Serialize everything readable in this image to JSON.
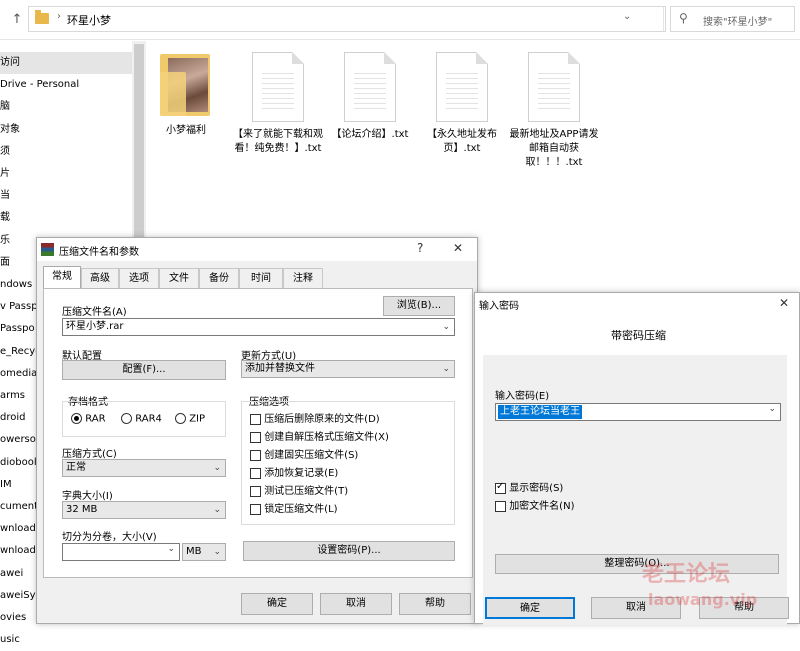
{
  "explorer": {
    "address": "环星小梦",
    "search_placeholder": "搜索\"环星小梦\"",
    "sidebar": [
      "访问",
      "Drive - Personal",
      "脑",
      "对象",
      "须",
      "片",
      "当",
      "载",
      "乐",
      "面",
      "ndows (",
      "v Passpo",
      "Passpo",
      "e_Recyc",
      "omedia",
      "arms",
      "droid",
      "owersof",
      "diobool",
      "IM",
      "cument",
      "wnload",
      "wnload",
      "awei",
      "aweiSys",
      "ovies",
      "usic"
    ],
    "files": [
      {
        "name": "小梦福利",
        "type": "folder"
      },
      {
        "name": "【来了就能下载和观看！纯免费！】.txt",
        "type": "txt"
      },
      {
        "name": "【论坛介绍】.txt",
        "type": "txt"
      },
      {
        "name": "【永久地址发布页】.txt",
        "type": "txt"
      },
      {
        "name": "最新地址及APP请发邮箱自动获取！！！.txt",
        "type": "txt"
      }
    ]
  },
  "dlg1": {
    "title": "压缩文件名和参数",
    "help_btn": "?",
    "close_btn": "✕",
    "tabs": [
      "常规",
      "高级",
      "选项",
      "文件",
      "备份",
      "时间",
      "注释"
    ],
    "archive_name_label": "压缩文件名(A)",
    "browse": "浏览(B)...",
    "archive_name": "环星小梦.rar",
    "default_profile_label": "默认配置",
    "profile_btn": "配置(F)...",
    "update_mode_label": "更新方式(U)",
    "update_mode": "添加并替换文件",
    "format_label": "存档格式",
    "formats": [
      "RAR",
      "RAR4",
      "ZIP"
    ],
    "compress_options_label": "压缩选项",
    "options": [
      {
        "label": "压缩后删除原来的文件(D)",
        "checked": false
      },
      {
        "label": "创建自解压格式压缩文件(X)",
        "checked": false
      },
      {
        "label": "创建固实压缩文件(S)",
        "checked": false
      },
      {
        "label": "添加恢复记录(E)",
        "checked": false
      },
      {
        "label": "测试已压缩文件(T)",
        "checked": false
      },
      {
        "label": "锁定压缩文件(L)",
        "checked": false
      }
    ],
    "method_label": "压缩方式(C)",
    "method": "正常",
    "dict_label": "字典大小(I)",
    "dict": "32 MB",
    "split_label": "切分为分卷，大小(V)",
    "split_unit": "MB",
    "set_password": "设置密码(P)...",
    "ok": "确定",
    "cancel": "取消",
    "help": "帮助"
  },
  "dlg2": {
    "title": "输入密码",
    "close_btn": "✕",
    "heading": "带密码压缩",
    "input_label": "输入密码(E)",
    "password": "上老王论坛当老王",
    "show_password": "显示密码(S)",
    "encrypt_names": "加密文件名(N)",
    "organize": "整理密码(O)...",
    "ok": "确定",
    "cancel": "取消",
    "help": "帮助"
  },
  "watermark": {
    "cn": "老王论坛",
    "url": "laowang.vip"
  }
}
